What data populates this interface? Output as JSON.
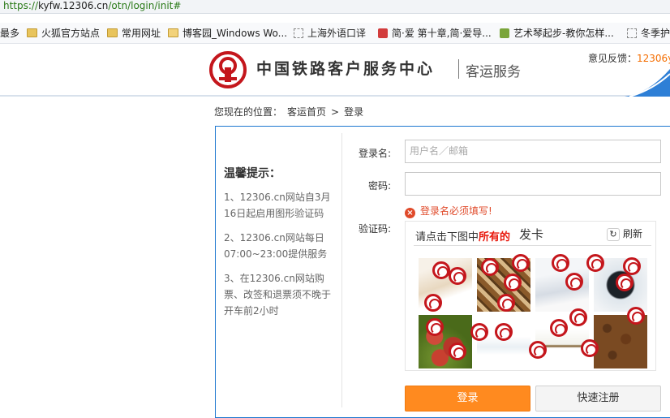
{
  "browser": {
    "url_scheme": "https://",
    "url_host": "kyfw.12306.cn",
    "url_path": "/otn/login/init#",
    "bookmarks": [
      "最多",
      "火狐官方站点",
      "常用网址",
      "博客园_Windows Wo...",
      "上海外语口译",
      "简·爱 第十章,简·爱导...",
      "艺术琴起步-教你怎样...",
      "冬季护"
    ]
  },
  "header": {
    "title": "中国铁路客户服务中心",
    "subtitle": "客运服务",
    "feedback_label": "意见反馈：",
    "feedback_email": "12306y"
  },
  "breadcrumb": {
    "prefix": "您现在的位置：",
    "home": "客运首页",
    "sep": ">",
    "current": "登录"
  },
  "tips": {
    "title": "温馨提示：",
    "items": [
      "1、12306.cn网站自3月16日起启用图形验证码",
      "2、12306.cn网站每日07:00~23:00提供服务",
      "3、在12306.cn网站购票、改签和退票须不晚于开车前2小时"
    ]
  },
  "form": {
    "username_label": "登录名:",
    "username_placeholder": "用户名／邮箱",
    "password_label": "密码:",
    "error": "登录名必须填写!",
    "captcha_label": "验证码:",
    "captcha_prompt_pre": "请点击下图中",
    "captcha_prompt_em": "所有的",
    "captcha_word": "发卡",
    "refresh_label": "刷新",
    "login_button": "登录",
    "register_button": "快速注册"
  },
  "colors": {
    "accent": "#ff8a1f",
    "brand_red": "#c4161c",
    "border_blue": "#1e78d0",
    "error": "#e04a2a"
  }
}
